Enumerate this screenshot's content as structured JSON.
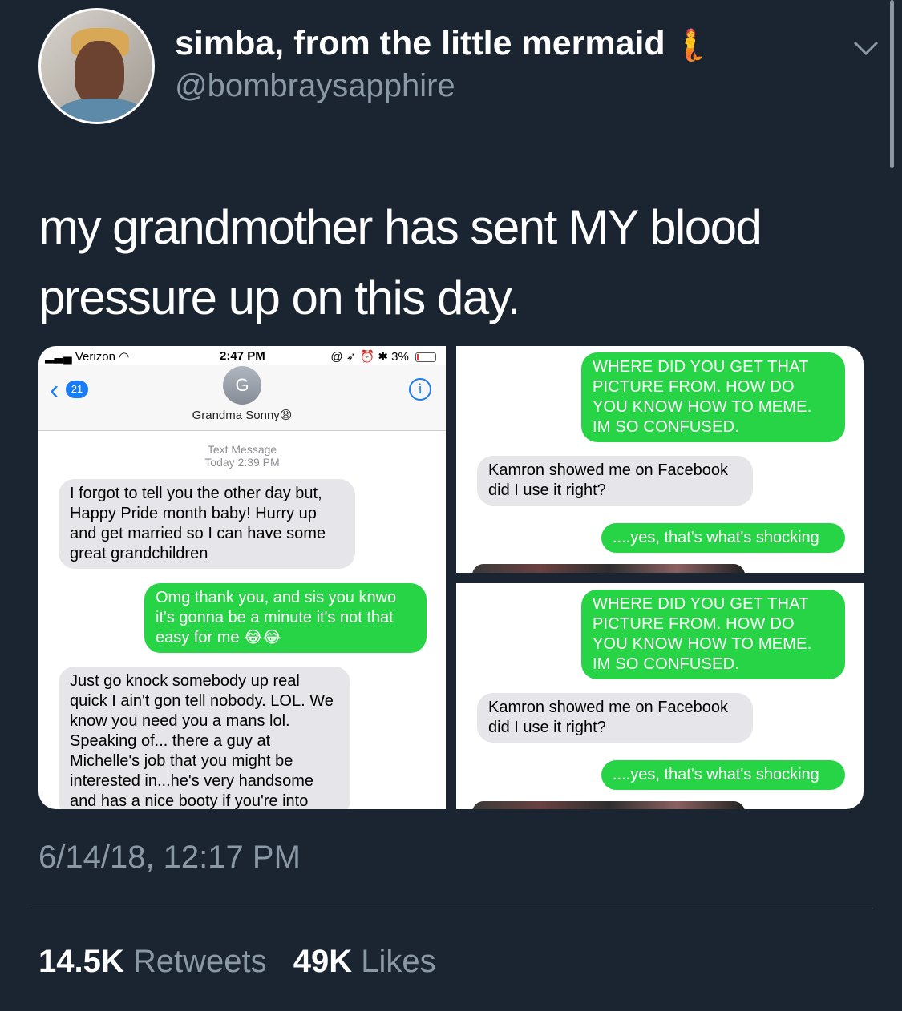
{
  "tweet": {
    "display_name": "simba, from the little mermaid",
    "display_name_icon": "merman-emoji",
    "handle": "@bombraysapphire",
    "text": "my grandmother has sent MY blood pressure up on this day.",
    "timestamp": "6/14/18, 12:17 PM",
    "retweets_count": "14.5K",
    "retweets_label": "Retweets",
    "likes_count": "49K",
    "likes_label": "Likes"
  },
  "screenshot_left": {
    "carrier": "Verizon",
    "time": "2:47 PM",
    "battery": "3%",
    "back_count": "21",
    "contact_initial": "G",
    "contact_name": "Grandma Sonny",
    "contact_emoji": "😩",
    "meta_type": "Text Message",
    "meta_time": "Today 2:39 PM",
    "messages": [
      {
        "dir": "in",
        "text": "I forgot to tell you the other day but, Happy Pride month baby! Hurry up and get married so I can have some great grandchildren"
      },
      {
        "dir": "out",
        "text": "Omg thank you, and sis you knwo it's gonna be a minute it's not that easy for me 😂😂"
      },
      {
        "dir": "in",
        "text": "Just go knock somebody up real quick I ain't gon tell nobody. LOL. We know you need you a mans lol. Speaking of... there a guy at Michelle's job that you might be interested in...he's very handsome and has a nice booty if you're into"
      }
    ]
  },
  "screenshot_right": {
    "msg_out_caps": "WHERE DID YOU GET THAT PICTURE FROM. HOW DO YOU KNOW HOW TO MEME. IM SO CONFUSED.",
    "msg_in": "Kamron showed me on Facebook did I use it right?",
    "msg_out": "....yes, that's what's shocking"
  }
}
